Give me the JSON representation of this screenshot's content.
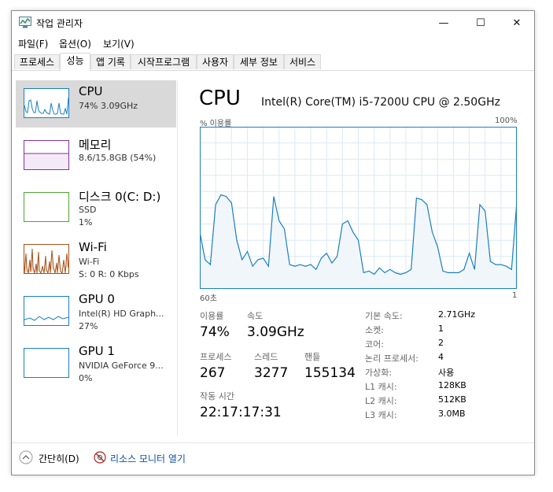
{
  "window": {
    "title": "작업 관리자",
    "minimize": "—",
    "maximize": "☐",
    "close": "✕"
  },
  "menu": {
    "file": "파일(F)",
    "options": "옵션(O)",
    "view": "보기(V)"
  },
  "tabs": [
    {
      "label": "프로세스"
    },
    {
      "label": "성능"
    },
    {
      "label": "앱 기록"
    },
    {
      "label": "시작프로그램"
    },
    {
      "label": "사용자"
    },
    {
      "label": "세부 정보"
    },
    {
      "label": "서비스"
    }
  ],
  "active_tab": 1,
  "resources": [
    {
      "name": "CPU",
      "line1": "74% 3.09GHz",
      "line2": "",
      "color": "#1a7fc3",
      "selected": true
    },
    {
      "name": "메모리",
      "line1": "8.6/15.8GB (54%)",
      "line2": "",
      "color": "#8b2fa3"
    },
    {
      "name": "디스크 0(C: D:)",
      "line1": "SSD",
      "line2": "1%",
      "color": "#4da533"
    },
    {
      "name": "Wi-Fi",
      "line1": "Wi-Fi",
      "line2": "S: 0 R: 0 Kbps",
      "color": "#a7531a"
    },
    {
      "name": "GPU 0",
      "line1": "Intel(R) HD Graph...",
      "line2": "27%",
      "color": "#1a7fc3"
    },
    {
      "name": "GPU 1",
      "line1": "NVIDIA GeForce 9...",
      "line2": "0%",
      "color": "#1a7fc3"
    }
  ],
  "cpu": {
    "title": "CPU",
    "model": "Intel(R) Core(TM) i5-7200U CPU @ 2.50GHz",
    "graph_label_tl": "% 이용률",
    "graph_label_tr": "100%",
    "graph_label_bl": "60초",
    "graph_label_br": "1",
    "color_line": "#1a7fc3",
    "color_fill": "#f1f6fa",
    "color_grid": "#d9eaf5"
  },
  "chart_data": {
    "type": "area",
    "ylim": [
      0,
      100
    ],
    "values": [
      35,
      18,
      15,
      52,
      58,
      57,
      53,
      30,
      18,
      23,
      14,
      18,
      19,
      14,
      57,
      42,
      37,
      15,
      14,
      15,
      14,
      15,
      12,
      19,
      22,
      16,
      20,
      40,
      42,
      35,
      30,
      10,
      11,
      9,
      13,
      10,
      12,
      10,
      9,
      10,
      12,
      56,
      55,
      52,
      35,
      26,
      11,
      10,
      10,
      10,
      12,
      22,
      12,
      52,
      48,
      17,
      15,
      15,
      14,
      12,
      54
    ]
  },
  "stats": {
    "utilization_label": "이용률",
    "utilization": "74%",
    "speed_label": "속도",
    "speed": "3.09GHz",
    "processes_label": "프로세스",
    "processes": "267",
    "threads_label": "스레드",
    "threads": "3277",
    "handles_label": "핸들",
    "handles": "155134",
    "uptime_label": "작동 시간",
    "uptime": "22:17:17:31"
  },
  "info": [
    {
      "label": "기본 속도:",
      "value": "2.71GHz"
    },
    {
      "label": "소켓:",
      "value": "1"
    },
    {
      "label": "코어:",
      "value": "2"
    },
    {
      "label": "논리 프로세서:",
      "value": "4"
    },
    {
      "label": "가상화:",
      "value": "사용"
    },
    {
      "label": "L1 캐시:",
      "value": "128KB"
    },
    {
      "label": "L2 캐시:",
      "value": "512KB"
    },
    {
      "label": "L3 캐시:",
      "value": "3.0MB"
    }
  ],
  "footer": {
    "collapse": "간단히(D)",
    "resource_monitor": "리소스 모니터 열기"
  }
}
